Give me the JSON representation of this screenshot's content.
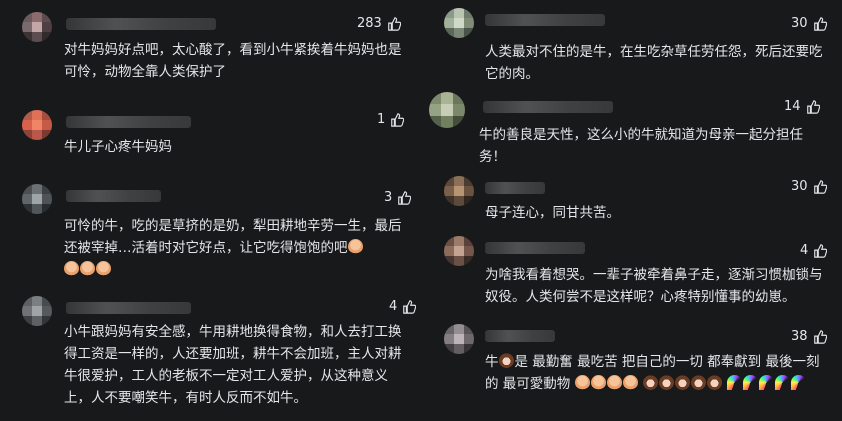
{
  "left_comments": [
    {
      "likes": "283",
      "text": "对牛妈妈好点吧，太心酸了，看到小牛紧挨着牛妈妈也是可怜，动物全靠人类保护了"
    },
    {
      "likes": "1",
      "text": "牛儿子心疼牛妈妈"
    },
    {
      "likes": "3",
      "text": "可怜的牛，吃的是草挤的是奶，犁田耕地辛劳一生，最后还被宰掉…活着时对它好点，让它吃得饱饱的吧",
      "emoji": [
        "pray",
        "pray",
        "pray",
        "pray"
      ]
    },
    {
      "likes": "4",
      "text": "小牛跟妈妈有安全感，牛用耕地换得食物，和人去打工换得工资是一样的，人还要加班，耕牛不会加班，主人对耕牛很爱护，工人的老板不一定对工人爱护，从这种意义上，人不要嘲笑牛，有时人反而不如牛。"
    }
  ],
  "right_comments": [
    {
      "likes": "30",
      "text": "人类最对不住的是牛，在生吃杂草任劳任怨，死后还要吃它的肉。"
    },
    {
      "likes": "14",
      "text": "牛的善良是天性，这么小的牛就知道为母亲一起分担任务！"
    },
    {
      "likes": "30",
      "text": "母子连心，同甘共苦。"
    },
    {
      "likes": "4",
      "text": "为啥我看着想哭。一辈子被牵着鼻子走，逐渐习惯枷锁与奴役。人类何尝不是这样呢？心疼特别懂事的幼崽。"
    },
    {
      "likes": "38",
      "text_a": "牛",
      "text_b": "是 最勤奮 最吃苦 把自己的一切 都奉獻到 最後一刻的 最可愛動物",
      "emoji_tail": [
        "pray",
        "pray",
        "pray",
        "pray",
        "cow",
        "cow",
        "cow",
        "cow",
        "cow",
        "rain",
        "rain",
        "rain",
        "rain",
        "rain"
      ]
    }
  ],
  "colors": {
    "background": "#18191a",
    "text": "#e4e6eb"
  }
}
